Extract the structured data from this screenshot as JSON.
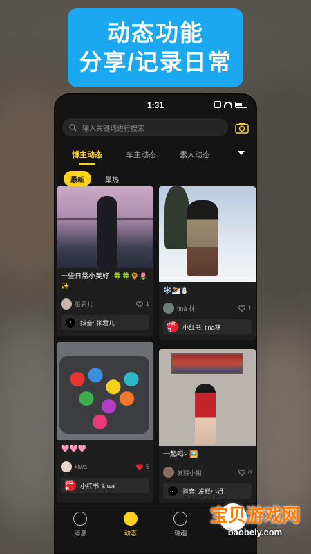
{
  "banner": {
    "line1": "动态功能",
    "line2": "分享/记录日常"
  },
  "status_bar": {
    "time": "1:31"
  },
  "search": {
    "placeholder": "输入关键词进行搜索"
  },
  "tabs": [
    {
      "label": "博主动态",
      "active": true
    },
    {
      "label": "车主动态",
      "active": false
    },
    {
      "label": "素人动态",
      "active": false
    }
  ],
  "subtabs": [
    {
      "label": "最新",
      "active": true
    },
    {
      "label": "最热",
      "active": false
    }
  ],
  "cards": [
    {
      "caption": "一些日常小美好~🍀🍀🌻🌷✨",
      "user": "张君儿",
      "likes": "1",
      "liked": false,
      "source_label": "抖音: 张君儿",
      "source_type": "douyin"
    },
    {
      "caption": "❄️⛷️☃️",
      "user": "tina 林",
      "likes": "1",
      "liked": false,
      "source_label": "小红书: tina林",
      "source_type": "xiaohongshu"
    },
    {
      "caption": "🩷🩷🩷",
      "user": "kiwa",
      "likes": "5",
      "liked": true,
      "source_label": "小红书: kiwa",
      "source_type": "xiaohongshu"
    },
    {
      "caption": "一起吗? 🖼️",
      "user": "发糕小姐",
      "likes": "0",
      "liked": false,
      "source_label": "抖音: 发糕小姐",
      "source_type": "douyin"
    }
  ],
  "logos": {
    "douyin": "♪",
    "xiaohongshu": "小红书"
  },
  "bottom_nav": [
    {
      "label": "消息",
      "icon": "message-icon",
      "active": false
    },
    {
      "label": "动态",
      "icon": "compass-icon",
      "active": true
    },
    {
      "label": "瑞趣",
      "icon": "people-icon",
      "active": false
    },
    {
      "label": "",
      "icon": "user-icon",
      "active": false
    }
  ],
  "watermark": {
    "title": "宝贝游戏网",
    "url": "baobeiy.com"
  },
  "colors": {
    "accent": "#ffd21e",
    "banner": "#1ba8f0",
    "xiaohongshu": "#e5232e"
  }
}
